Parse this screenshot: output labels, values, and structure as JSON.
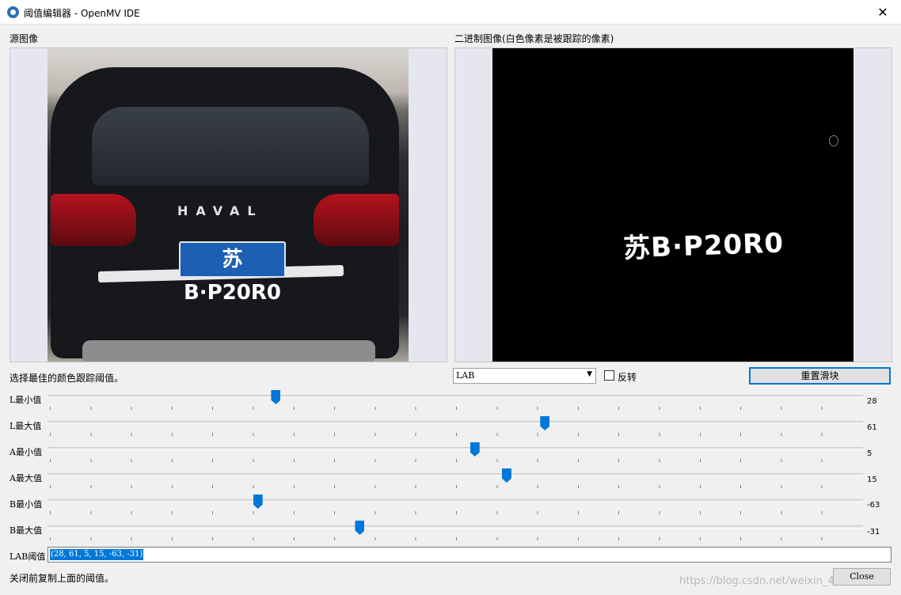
{
  "window": {
    "title": "阈值编辑器 - OpenMV IDE",
    "close_glyph": "✕"
  },
  "source_pane": {
    "label": "源图像",
    "plate_text": "苏B·P20R0",
    "brand_text": "HAVAL"
  },
  "binary_pane": {
    "label": "二进制图像(白色像素是被跟踪的像素)",
    "plate_text": "苏B·P20R0"
  },
  "controls": {
    "instruction": "选择最佳的颜色跟踪阈值。",
    "color_space": "LAB",
    "combo_arrow": "▼",
    "invert_label": "反转",
    "invert_checked": false,
    "reset_button": "重置滑块"
  },
  "sliders": [
    {
      "label": "L最小值",
      "value": "28",
      "fraction": 0.28
    },
    {
      "label": "L最大值",
      "value": "61",
      "fraction": 0.61
    },
    {
      "label": "A最小值",
      "value": "5",
      "fraction": 0.524
    },
    {
      "label": "A最大值",
      "value": "15",
      "fraction": 0.563
    },
    {
      "label": "B最小值",
      "value": "-63",
      "fraction": 0.258
    },
    {
      "label": "B最大值",
      "value": "-31",
      "fraction": 0.383
    }
  ],
  "lab_threshold": {
    "label": "LAB阈值",
    "value": "(28, 61, 5, 15, -63, -31)"
  },
  "footer": {
    "note": "关闭前复制上面的阈值。",
    "close_button": "Close",
    "watermark": "https://blog.csdn.net/weixin_45701403"
  },
  "colors": {
    "accent": "#0078d7",
    "plate_blue": "#1d5fb3"
  }
}
